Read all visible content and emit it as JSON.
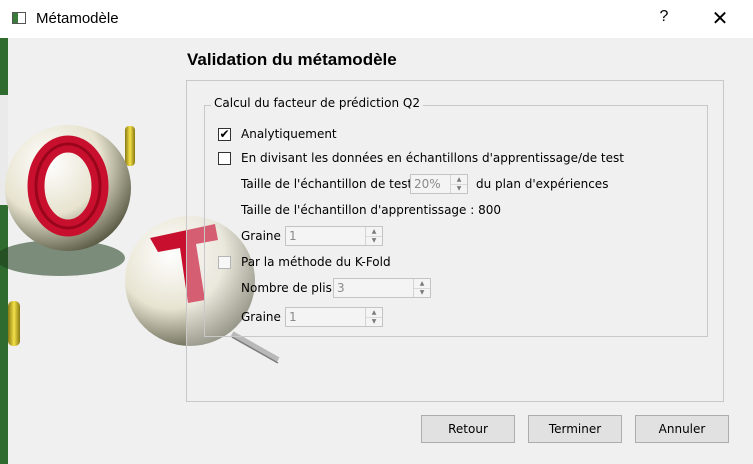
{
  "window": {
    "title": "Métamodèle",
    "help_label": "?",
    "close_label": "✕"
  },
  "page": {
    "heading": "Validation du métamodèle"
  },
  "group": {
    "title": "Calcul du facteur de prédiction Q2",
    "analytic": {
      "label": "Analytiquement",
      "checked": true,
      "check_mark": "✔"
    },
    "split": {
      "label": "En divisant les données en échantillons d'apprentissage/de test",
      "checked": false,
      "test_size_label": "Taille de l'échantillon de test",
      "test_size_value": "20%",
      "test_size_suffix": "du plan d'expériences",
      "train_size_text": "Taille de l'échantillon d'apprentissage : 800",
      "seed_label": "Graine",
      "seed_value": "1"
    },
    "kfold": {
      "label": "Par la méthode du K-Fold",
      "checked": false,
      "folds_label": "Nombre de plis",
      "folds_value": "3",
      "seed_label": "Graine",
      "seed_value": "1"
    }
  },
  "buttons": {
    "back": "Retour",
    "finish": "Terminer",
    "cancel": "Annuler"
  },
  "spin_arrows": {
    "up": "▲",
    "down": "▼"
  },
  "icons": {
    "app": "app-window-icon",
    "logo": "openturns-logo-icon"
  },
  "colors": {
    "title_bar": "#ffffff",
    "window_bg": "#f0f0f0",
    "button_bg": "#e1e1e1"
  }
}
